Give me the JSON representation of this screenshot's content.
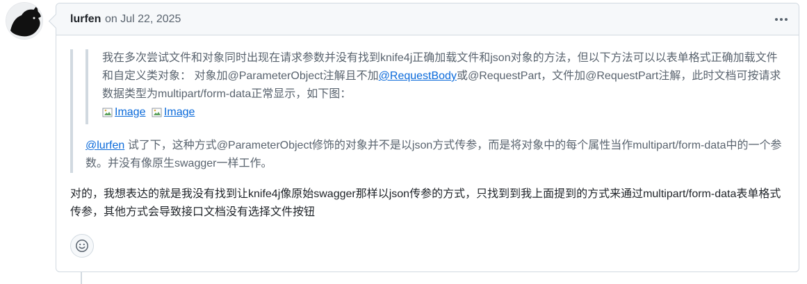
{
  "comment": {
    "author": "lurfen",
    "timestamp": "on Jul 22, 2025",
    "menu_icon": "kebab-horizontal-icon",
    "quote": {
      "inner_part1": "我在多次尝试文件和对象同时出现在请求参数并没有找到knife4j正确加载文件和json对象的方法，但以下方法可以以表单格式正确加载文件和自定义类对象： 对象加@ParameterObject注解且不加",
      "inner_link": "@RequestBody",
      "inner_part2": "或@RequestPart，文件加@RequestPart注解，此时文档可按请求数据类型为multipart/form-data正常显示，如下图：",
      "images": [
        "Image",
        "Image"
      ],
      "mention": "@lurfen",
      "outer_text": " 试了下，这种方式@ParameterObject修饰的对象并不是以json方式传参，而是将对象中的每个属性当作multipart/form-data中的一个参数。并没有像原生swagger一样工作。"
    },
    "reply_text": "对的，我想表达的就是我没有找到让knife4j像原始swagger那样以json传参的方式，只找到到我上面提到的方式来通过multipart/form-data表单格式传参，其他方式会导致接口文档没有选择文件按钮",
    "reaction_icon": "smiley-icon"
  }
}
